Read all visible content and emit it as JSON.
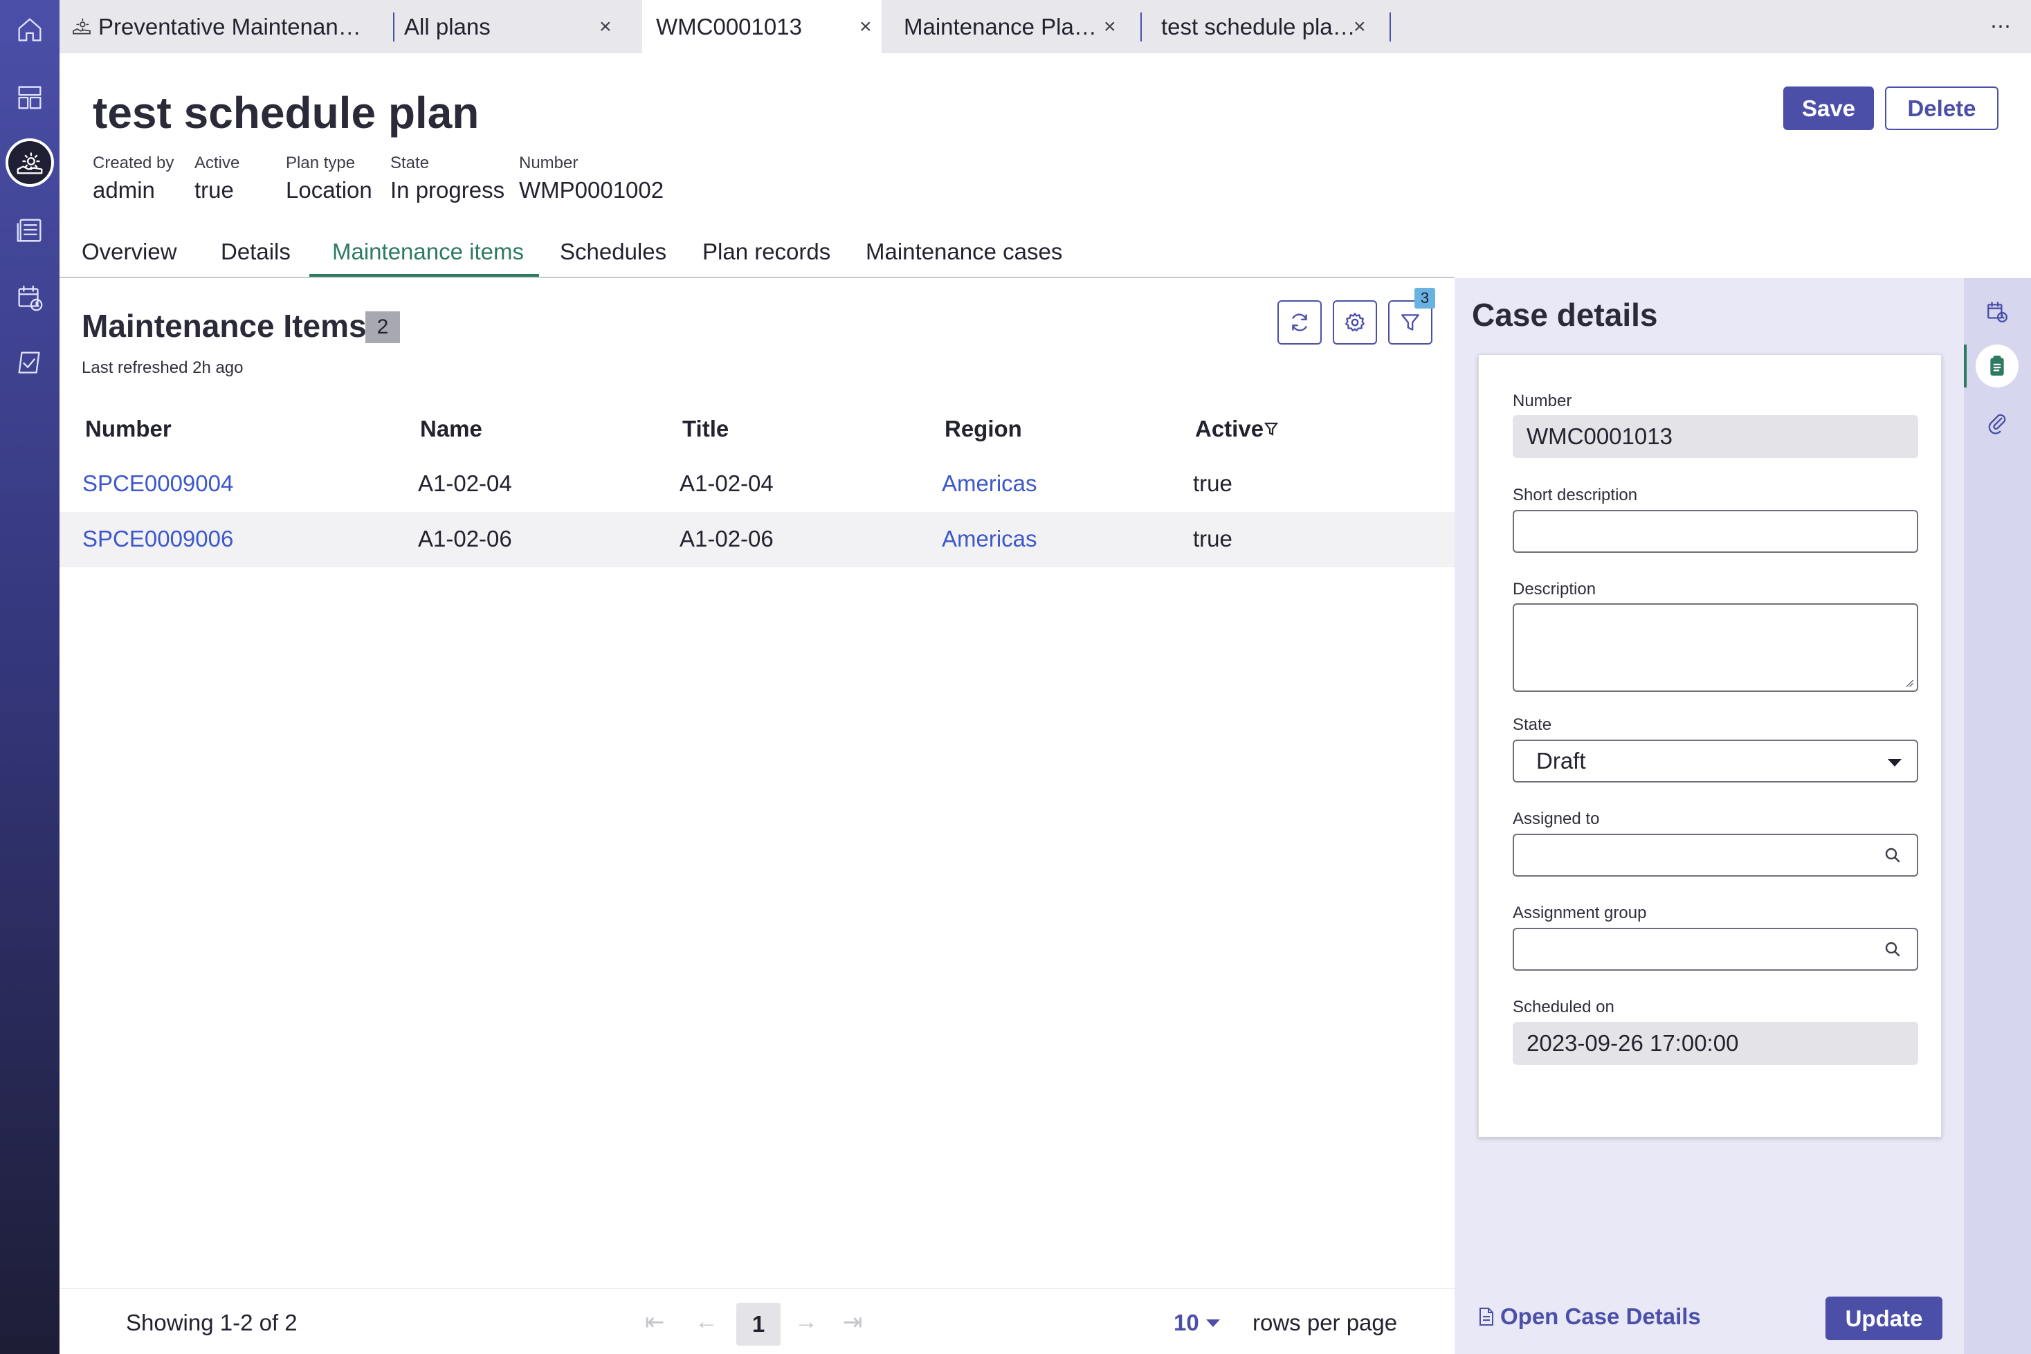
{
  "tabs": [
    {
      "label": "Preventative Maintenan…"
    },
    {
      "label": "All plans"
    },
    {
      "label": "WMC0001013"
    },
    {
      "label": "Maintenance Pla…"
    },
    {
      "label": "test schedule pla…"
    }
  ],
  "tab_close": "×",
  "more_menu": "⋯",
  "header": {
    "title": "test schedule plan",
    "save_label": "Save",
    "delete_label": "Delete",
    "meta": [
      {
        "label": "Created by",
        "value": "admin"
      },
      {
        "label": "Active",
        "value": "true"
      },
      {
        "label": "Plan type",
        "value": "Location"
      },
      {
        "label": "State",
        "value": "In progress"
      },
      {
        "label": "Number",
        "value": "WMP0001002"
      }
    ]
  },
  "subtabs": [
    "Overview",
    "Details",
    "Maintenance items",
    "Schedules",
    "Plan records",
    "Maintenance cases"
  ],
  "active_subtab": "Maintenance items",
  "list": {
    "title": "Maintenance Items",
    "count": "2",
    "refreshed": "Last refreshed 2h ago",
    "filter_count": "3",
    "columns": [
      "Number",
      "Name",
      "Title",
      "Region",
      "Active"
    ],
    "rows": [
      {
        "number": "SPCE0009004",
        "name": "A1-02-04",
        "title": "A1-02-04",
        "region": "Americas",
        "active": "true"
      },
      {
        "number": "SPCE0009006",
        "name": "A1-02-06",
        "title": "A1-02-06",
        "region": "Americas",
        "active": "true"
      }
    ]
  },
  "pagination": {
    "showing": "Showing 1-2 of 2",
    "page": "1",
    "rows_per_page": "10",
    "rows_per_page_label": "rows per page"
  },
  "case_details": {
    "title": "Case details",
    "fields": {
      "number": {
        "label": "Number",
        "value": "WMC0001013"
      },
      "short_description": {
        "label": "Short description",
        "value": ""
      },
      "description": {
        "label": "Description",
        "value": ""
      },
      "state": {
        "label": "State",
        "value": "Draft"
      },
      "assigned_to": {
        "label": "Assigned to",
        "value": ""
      },
      "assignment_group": {
        "label": "Assignment group",
        "value": ""
      },
      "scheduled_on": {
        "label": "Scheduled on",
        "value": "2023-09-26 17:00:00"
      }
    },
    "open_link": "Open Case Details",
    "update_label": "Update"
  },
  "colors": {
    "accent": "#4b4fa8",
    "active_tab": "#2e7a5f",
    "link": "#3d58c9",
    "filter_badge": "#6ab2e2"
  }
}
